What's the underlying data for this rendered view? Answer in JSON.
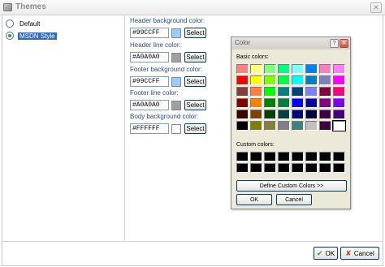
{
  "window": {
    "title": "Themes",
    "close_label": "✕"
  },
  "themes": [
    {
      "label": "Default",
      "checked": false
    },
    {
      "label": "MSDN Style",
      "checked": true
    }
  ],
  "settings": [
    {
      "label": "Header background color:",
      "value": "#99CCFF",
      "color": "#99CCFF",
      "button": "Select"
    },
    {
      "label": "Header line color:",
      "value": "#A0A0A0",
      "color": "#A0A0A0",
      "button": "Select"
    },
    {
      "label": "Footer background color:",
      "value": "#99CCFF",
      "color": "#99CCFF",
      "button": "Select"
    },
    {
      "label": "Footer line color:",
      "value": "#A0A0A0",
      "color": "#A0A0A0",
      "button": "Select"
    },
    {
      "label": "Body background color:",
      "value": "#FFFFFF",
      "color": "#FFFFFF",
      "button": "Select"
    }
  ],
  "buttons": {
    "ok": "OK",
    "cancel": "Cancel"
  },
  "color_dialog": {
    "title": "Color",
    "help_label": "?",
    "close_label": "✕",
    "basic_label": "Basic colors:",
    "custom_label": "Custom colors:",
    "define_label": "Define Custom Colors >>",
    "ok_label": "OK",
    "cancel_label": "Cancel",
    "basic_colors": [
      "#FF8080",
      "#FFFF80",
      "#80FF80",
      "#00FF80",
      "#80FFFF",
      "#0080FF",
      "#FF80C0",
      "#FF80FF",
      "#FF0000",
      "#FFFF00",
      "#80FF00",
      "#00FF40",
      "#00FFFF",
      "#0080C0",
      "#8080C0",
      "#FF00FF",
      "#804040",
      "#FF8040",
      "#00FF00",
      "#008080",
      "#004080",
      "#8080FF",
      "#800040",
      "#FF0080",
      "#800000",
      "#FF8000",
      "#008000",
      "#008040",
      "#0000FF",
      "#0000A0",
      "#800080",
      "#8000FF",
      "#400000",
      "#804000",
      "#004000",
      "#004040",
      "#000080",
      "#000040",
      "#400040",
      "#400080",
      "#000000",
      "#808000",
      "#808040",
      "#808080",
      "#408080",
      "#C0C0C0",
      "#400040",
      "#FFFFFF"
    ],
    "selected_index": 47,
    "custom_colors": [
      "#000000",
      "#000000",
      "#000000",
      "#000000",
      "#000000",
      "#000000",
      "#000000",
      "#000000",
      "#000000",
      "#000000",
      "#000000",
      "#000000",
      "#000000",
      "#000000",
      "#000000",
      "#000000"
    ]
  },
  "icons": {
    "ok_icon": "✔",
    "cancel_icon": "✘"
  },
  "colors": {
    "accent": "#3169C6",
    "ok_icon": "#2E9A2E",
    "cancel_icon": "#D03A2A"
  }
}
